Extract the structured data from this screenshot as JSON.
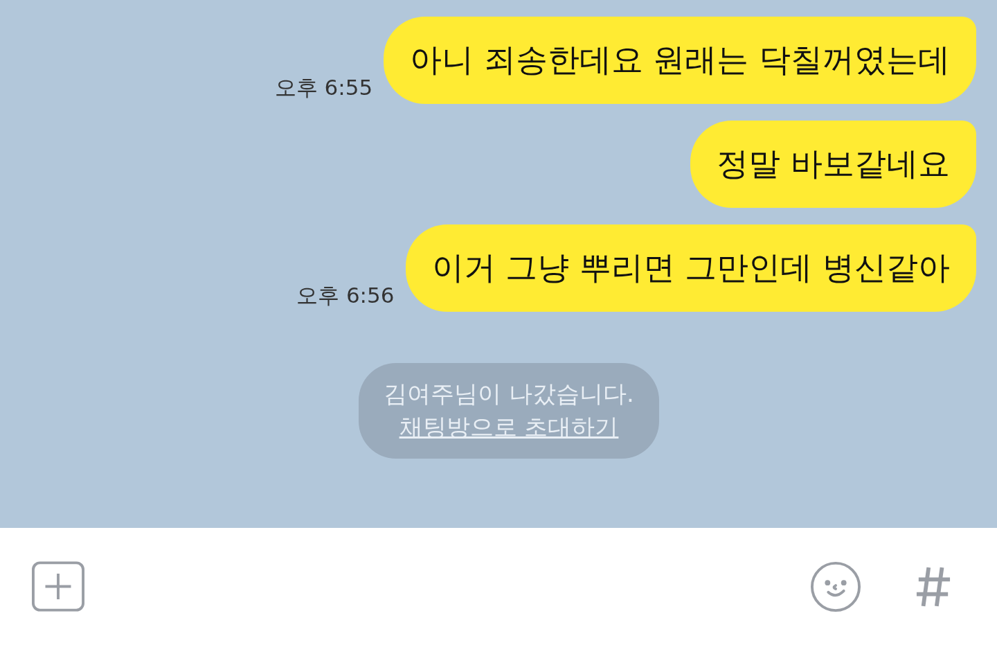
{
  "messages": [
    {
      "text": "아니 죄송한데요 원래는 닥칠꺼였는데",
      "time": "오후 6:55"
    },
    {
      "text": "정말 바보같네요"
    },
    {
      "text": "이거 그냥 뿌리면 그만인데 병신같아",
      "time": "오후 6:56"
    }
  ],
  "notice": {
    "text": "김여주님이 나갔습니다.",
    "link": "채팅방으로 초대하기"
  }
}
